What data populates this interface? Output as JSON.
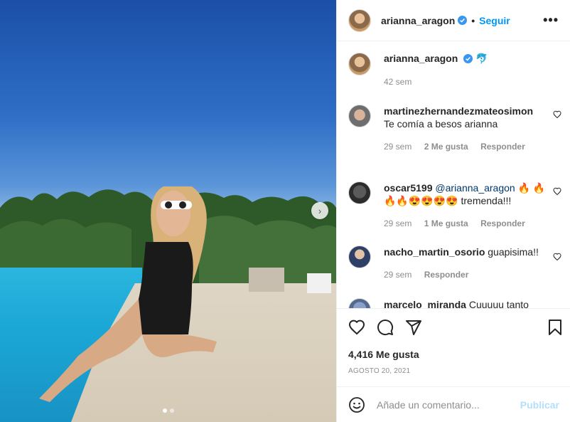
{
  "post": {
    "author": "arianna_aragon",
    "follow_label": "Seguir",
    "separator": "•",
    "more_icon": "more-options-icon",
    "image": {
      "carousel_position": 1,
      "carousel_total": 2,
      "next_icon": "chevron-right-icon"
    }
  },
  "caption": {
    "author": "arianna_aragon",
    "text": "🐬",
    "time": "42 sem"
  },
  "comments": [
    {
      "author": "martinezhernandezmateosimon",
      "text": "Te comía a besos arianna",
      "time": "29 sem",
      "likes": "2 Me gusta",
      "reply": "Responder"
    },
    {
      "author": "oscar5199",
      "mention": "@arianna_aragon",
      "text": "🔥 🔥🔥🔥😍😍😍😍 tremenda!!!",
      "time": "29 sem",
      "likes": "1 Me gusta",
      "reply": "Responder"
    },
    {
      "author": "nacho_martin_osorio",
      "text": "guapisima!!",
      "time": "29 sem",
      "reply": "Responder"
    },
    {
      "author": "marcelo_miranda",
      "text": "Cuuuuu tanto"
    }
  ],
  "stats": {
    "likes": "4,416 Me gusta",
    "date": "AGOSTO 20, 2021"
  },
  "add_comment": {
    "placeholder": "Añade un comentario...",
    "publish_label": "Publicar"
  },
  "colors": {
    "accent": "#0095f6",
    "verified": "#3897f0",
    "muted": "#8e8e8e",
    "publish_disabled": "#b2dffc"
  }
}
